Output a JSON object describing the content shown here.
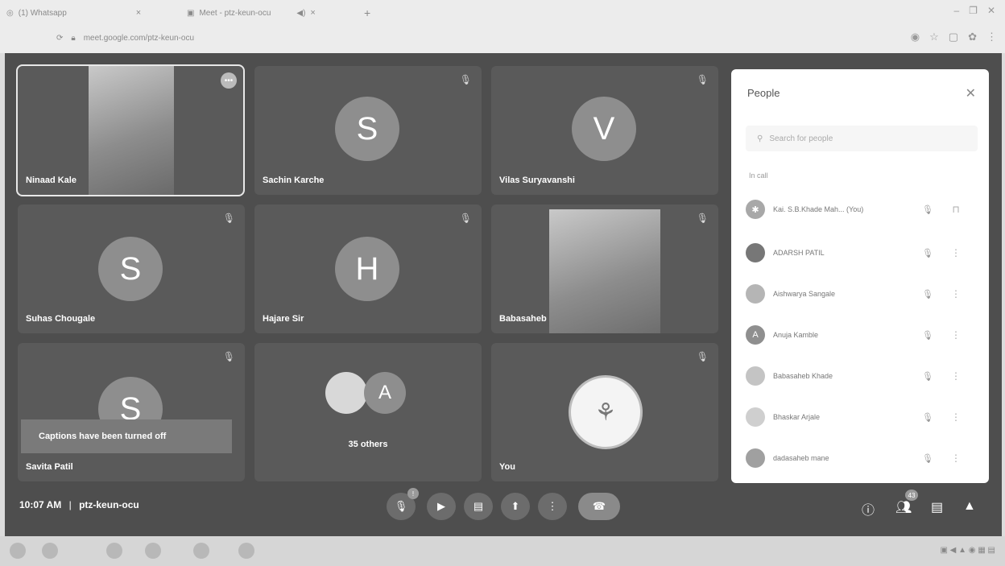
{
  "browser": {
    "tabs": [
      {
        "label": "(1) Whatsapp",
        "close": "×"
      },
      {
        "label": "Meet - ptz-keun-ocu",
        "close": "×"
      }
    ],
    "new_tab": "+",
    "url": "meet.google.com/ptz-keun-ocu"
  },
  "tiles": [
    {
      "name": "Ninaad Kale"
    },
    {
      "name": "Sachin Karche",
      "initial": "S"
    },
    {
      "name": "Vilas Suryavanshi",
      "initial": "V"
    },
    {
      "name": "Suhas Chougale",
      "initial": "S"
    },
    {
      "name": "Hajare Sir",
      "initial": "H"
    },
    {
      "name": "Babasaheb Khade"
    },
    {
      "name": "Savita Patil",
      "initial": "S"
    },
    {
      "name": "35 others",
      "initial": "A"
    },
    {
      "name": "You"
    }
  ],
  "captions_toast": "Captions have been turned off",
  "people_panel": {
    "title": "People",
    "search_placeholder": "Search for people",
    "section_label": "In call",
    "participants": [
      {
        "name": "Kai. S.B.Khade Mah... (You)",
        "initial": ""
      },
      {
        "name": "ADARSH PATIL",
        "initial": ""
      },
      {
        "name": "Aishwarya Sangale",
        "initial": ""
      },
      {
        "name": "Anuja Kamble",
        "initial": "A"
      },
      {
        "name": "Babasaheb Khade",
        "initial": ""
      },
      {
        "name": "Bhaskar Arjale",
        "initial": ""
      },
      {
        "name": "dadasaheb mane",
        "initial": ""
      }
    ]
  },
  "bottom_bar": {
    "time": "10:07 AM",
    "separator": "|",
    "meeting_code": "ptz-keun-ocu",
    "people_count": "43"
  },
  "icons": {
    "mic_off": "mic-off-icon",
    "more": "more-vert-icon",
    "pin": "pin-icon"
  }
}
